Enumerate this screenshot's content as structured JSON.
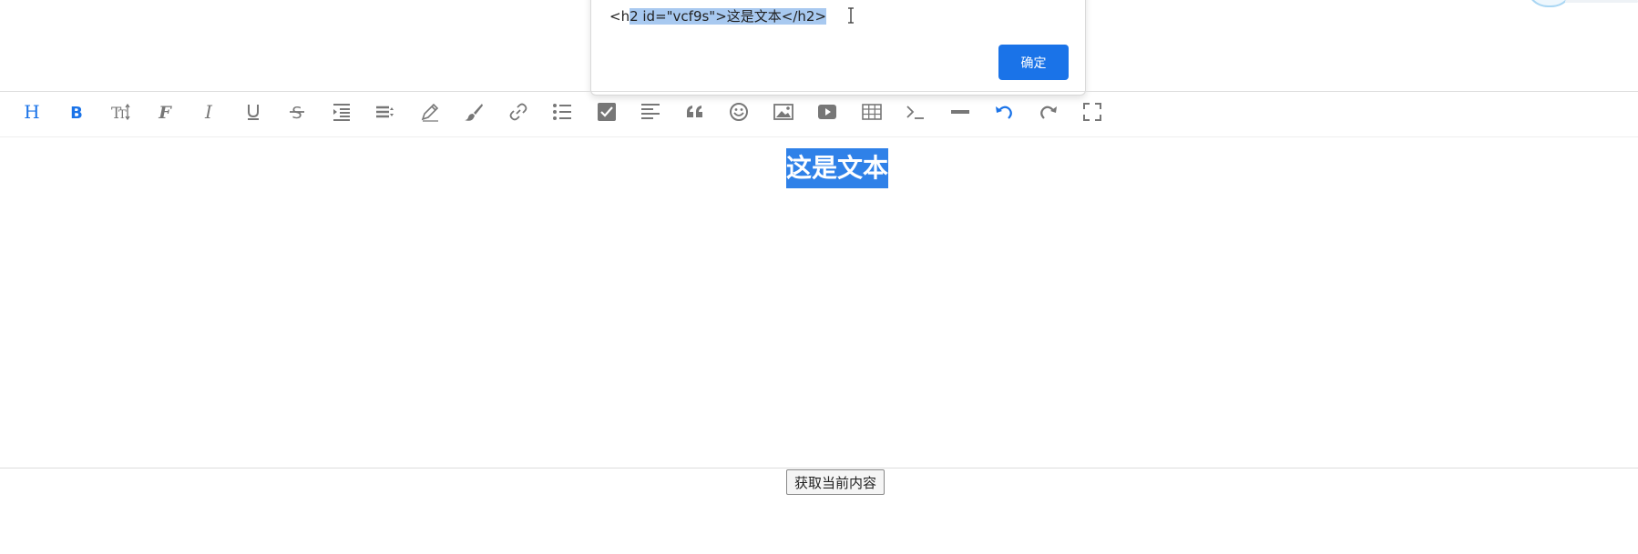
{
  "dialog": {
    "message_prefix": "<h",
    "message_selected": "2 id=\"vcf9s\">这是文本</h2>",
    "ok_label": "确定"
  },
  "toolbar": {
    "tools": [
      {
        "name": "header-icon",
        "active": true
      },
      {
        "name": "bold-icon",
        "active": true
      },
      {
        "name": "font-size-icon",
        "active": false
      },
      {
        "name": "font-family-icon",
        "active": false
      },
      {
        "name": "italic-icon",
        "active": false
      },
      {
        "name": "underline-icon",
        "active": false
      },
      {
        "name": "strikethrough-icon",
        "active": false
      },
      {
        "name": "indent-icon",
        "active": false
      },
      {
        "name": "line-height-icon",
        "active": false
      },
      {
        "name": "text-color-icon",
        "active": false
      },
      {
        "name": "background-color-icon",
        "active": false
      },
      {
        "name": "link-icon",
        "active": false
      },
      {
        "name": "list-icon",
        "active": false
      },
      {
        "name": "todo-icon",
        "active": false
      },
      {
        "name": "justify-icon",
        "active": false
      },
      {
        "name": "quote-icon",
        "active": false
      },
      {
        "name": "emoticon-icon",
        "active": false
      },
      {
        "name": "image-icon",
        "active": false
      },
      {
        "name": "video-icon",
        "active": false
      },
      {
        "name": "table-icon",
        "active": false
      },
      {
        "name": "code-icon",
        "active": false
      },
      {
        "name": "split-line-icon",
        "active": false
      },
      {
        "name": "undo-icon",
        "active": true
      },
      {
        "name": "redo-icon",
        "active": false
      },
      {
        "name": "fullscreen-icon",
        "active": false
      }
    ]
  },
  "editor": {
    "heading_text": "这是文本"
  },
  "actions": {
    "get_content_label": "获取当前内容"
  },
  "colors": {
    "active_icon": "#1a73e8",
    "inactive_icon": "#777777",
    "selection": "#2f81e8"
  }
}
